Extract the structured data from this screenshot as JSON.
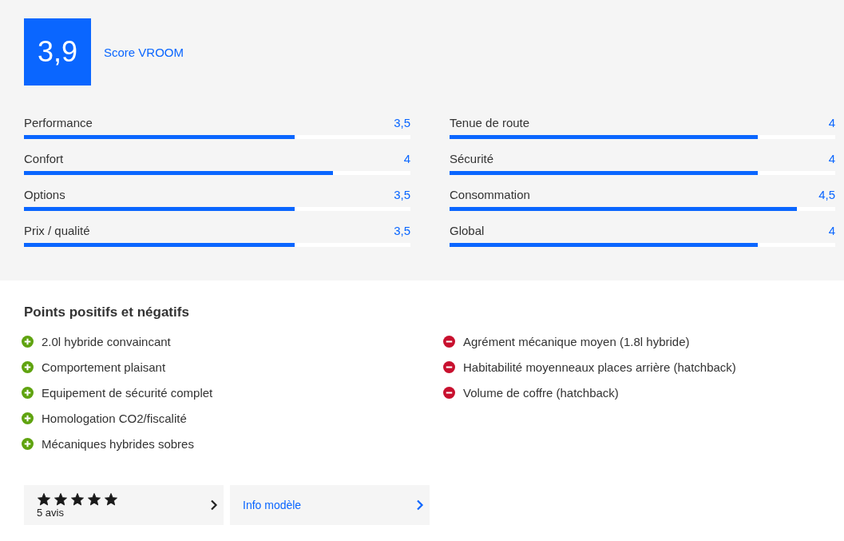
{
  "score": {
    "value": "3,9",
    "label": "Score VROOM"
  },
  "ratings": [
    {
      "name": "Performance",
      "reading": "3,5",
      "level": 0.7
    },
    {
      "name": "Confort",
      "reading": "4",
      "level": 0.8
    },
    {
      "name": "Options",
      "reading": "3,5",
      "level": 0.7
    },
    {
      "name": "Prix / qualité",
      "reading": "3,5",
      "level": 0.7
    },
    {
      "name": "Tenue de route",
      "reading": "4",
      "level": 0.8
    },
    {
      "name": "Sécurité",
      "reading": "4",
      "level": 0.8
    },
    {
      "name": "Consommation",
      "reading": "4,5",
      "level": 0.9
    },
    {
      "name": "Global",
      "reading": "4",
      "level": 0.8
    }
  ],
  "points": {
    "title": "Points positifs et négatifs",
    "positive": [
      "2.0l hybride convaincant",
      "Comportement plaisant",
      "Equipement de sécurité complet",
      "Homologation CO2/fiscalité",
      "Mécaniques hybrides sobres"
    ],
    "negative": [
      "Agrément mécanique moyen (1.8l hybride)",
      "Habitabilité moyenneaux places arrière (hatchback)",
      "Volume de coffre (hatchback)"
    ]
  },
  "reviews": {
    "stars": 5,
    "count": "5 avis"
  },
  "info_link": {
    "label": "Info modèle"
  }
}
